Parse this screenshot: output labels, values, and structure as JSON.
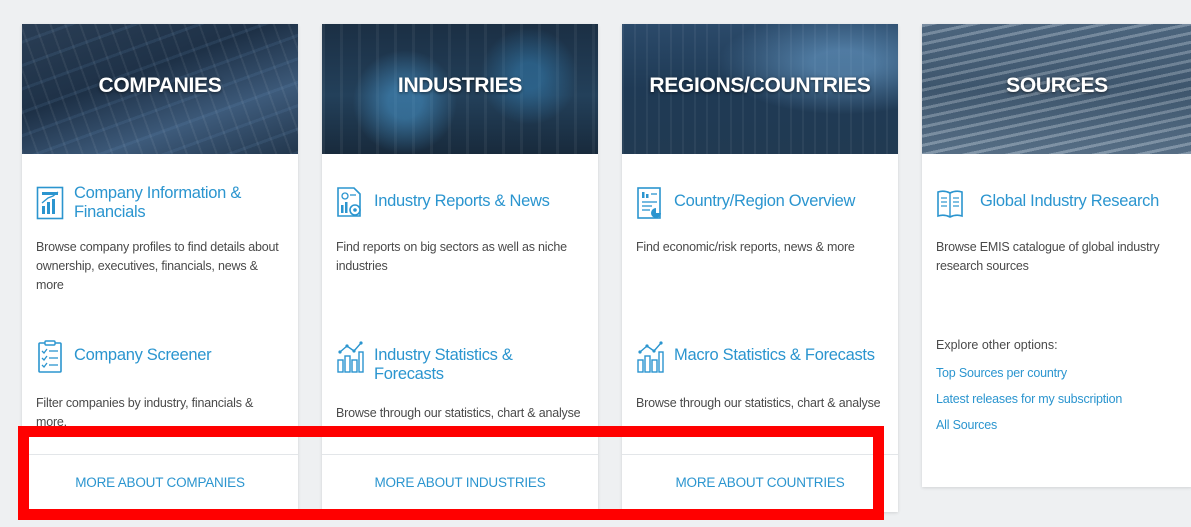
{
  "cards": {
    "companies": {
      "title": "COMPANIES",
      "item1": {
        "title": "Company Information & Financials",
        "desc": "Browse company profiles to find details about ownership, executives, financials, news & more"
      },
      "item2": {
        "title": "Company Screener",
        "desc": "Filter companies by industry, financials & more."
      },
      "more": "MORE ABOUT COMPANIES"
    },
    "industries": {
      "title": "INDUSTRIES",
      "item1": {
        "title": "Industry Reports & News",
        "desc": "Find reports on big sectors as well as niche industries"
      },
      "item2": {
        "title": "Industry Statistics & Forecasts",
        "desc": "Browse through our statistics, chart & analyse"
      },
      "more": "MORE ABOUT INDUSTRIES"
    },
    "regions": {
      "title": "REGIONS/COUNTRIES",
      "item1": {
        "title": "Country/Region Overview",
        "desc": "Find economic/risk reports, news & more"
      },
      "item2": {
        "title": "Macro Statistics & Forecasts",
        "desc": "Browse through our statistics, chart & analyse"
      },
      "more": "MORE ABOUT COUNTRIES"
    },
    "sources": {
      "title": "SOURCES",
      "item1": {
        "title": "Global Industry Research",
        "desc": "Browse EMIS catalogue of global industry research sources"
      },
      "explore_label": "Explore other options:",
      "links": [
        "Top Sources per country",
        "Latest releases for my subscription",
        "All Sources"
      ]
    }
  },
  "colors": {
    "accent": "#2b95cf",
    "highlight": "#ff0000",
    "text": "#4a4a4a"
  }
}
